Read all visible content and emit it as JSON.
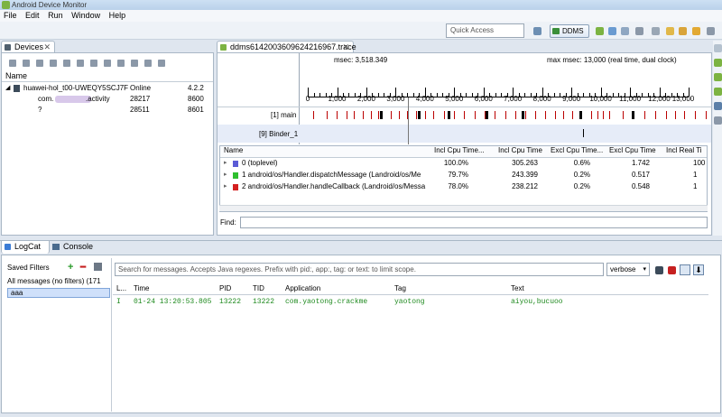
{
  "window": {
    "title": "Android Device Monitor"
  },
  "menu": [
    "File",
    "Edit",
    "Run",
    "Window",
    "Help"
  ],
  "toolbar": {
    "quick_access_placeholder": "Quick Access",
    "perspective_label": "DDMS"
  },
  "devices": {
    "tab_label": "Devices",
    "column_name": "Name",
    "rows": [
      {
        "name": "huawei-hol_t00-UWEQY5SCJ7F",
        "status": "Online",
        "version": "4.2.2"
      },
      {
        "name": "com.",
        "name_suffix": ".activity",
        "pid": "28217",
        "port": "8600"
      },
      {
        "name": "?",
        "pid": "28511",
        "port": "8601"
      }
    ]
  },
  "trace": {
    "tab_label": "ddms6142003609624216967.trace",
    "msec_label": "msec: 3,518.349",
    "max_msec_label": "max msec: 13,000 (real time, dual clock)",
    "ticks": [
      "0",
      "1,000",
      "2,000",
      "3,000",
      "4,000",
      "5,000",
      "6,000",
      "7,000",
      "8,000",
      "9,000",
      "10,000",
      "11,000",
      "12,000",
      "13,000"
    ],
    "threads": [
      "[1] main",
      "[9] Binder_1"
    ],
    "columns": [
      "Name",
      "Incl Cpu Time...",
      "Incl Cpu Time",
      "Excl Cpu Time...",
      "Excl Cpu Time",
      "Incl Real Ti"
    ],
    "rows": [
      {
        "color": "#5b5bd6",
        "name": "0 (toplevel)",
        "c1": "100.0%",
        "c2": "305.263",
        "c3": "0.6%",
        "c4": "1.742",
        "c5": "100"
      },
      {
        "color": "#2fbf2f",
        "name": "1 android/os/Handler.dispatchMessage (Landroid/os/Me",
        "c1": "79.7%",
        "c2": "243.399",
        "c3": "0.2%",
        "c4": "0.517",
        "c5": "1"
      },
      {
        "color": "#d42020",
        "name": "2 android/os/Handler.handleCallback (Landroid/os/Messa",
        "c1": "78.0%",
        "c2": "238.212",
        "c3": "0.2%",
        "c4": "0.548",
        "c5": "1"
      }
    ],
    "find_label": "Find:"
  },
  "logcat": {
    "tab_label": "LogCat",
    "console_tab_label": "Console",
    "saved_filters_label": "Saved Filters",
    "filters": [
      "All messages (no filters) (171",
      "aaa"
    ],
    "search_placeholder": "Search for messages. Accepts Java regexes. Prefix with pid:, app:, tag: or text: to limit scope.",
    "level": "verbose",
    "columns": [
      "L...",
      "Time",
      "PID",
      "TID",
      "Application",
      "Tag",
      "Text"
    ],
    "rows": [
      {
        "level": "I",
        "time": "01-24 13:20:53.805",
        "pid": "13222",
        "tid": "13222",
        "app": "com.yaotong.crackme",
        "tag": "yaotong",
        "text": "aiyou,bucuoo"
      }
    ]
  },
  "colors": {
    "log_info": "#1f8a1f",
    "selection": "#e6ecf8"
  }
}
